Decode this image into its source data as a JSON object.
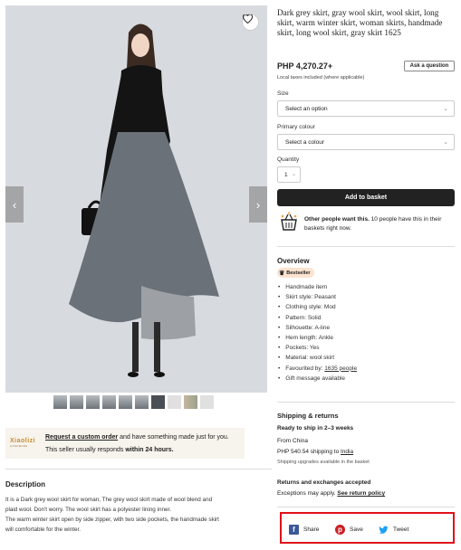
{
  "gallery": {
    "favorite_icon": "heart-icon",
    "prev_icon": "chevron-left-icon",
    "next_icon": "chevron-right-icon",
    "prev_glyph": "‹",
    "next_glyph": "›",
    "thumbnail_count": 10
  },
  "seller": {
    "logo_text": "Xiaolizi",
    "logo_subtext": "HANDMADE",
    "request_link": "Request a custom order",
    "request_rest": " and have something made just for you.",
    "responds_prefix": "This seller usually responds ",
    "responds_time": "within 24 hours."
  },
  "description": {
    "title": "Description",
    "lines": [
      "It is a Dark grey wool skirt for woman, The grey wool skirt made of wool blend and",
      "plaid wool. Don't worry. The wool skirt has a polyester lining inner.",
      "The warm winter skirt open by side zipper, with two side pockets, the handmade skirt",
      "will comfortable for the winter."
    ]
  },
  "product": {
    "title": "Dark grey skirt, gray wool skirt, wool skirt, long skirt, warm winter skirt, woman skirts, handmade skirt, long wool skirt, gray skirt 1625",
    "price": "PHP 4,270.27+",
    "ask_button": "Ask a question",
    "tax_note": "Local taxes included (where applicable)"
  },
  "options": {
    "size_label": "Size",
    "size_value": "Select an option",
    "colour_label": "Primary colour",
    "colour_value": "Select a colour",
    "quantity_label": "Quantity",
    "quantity_value": "1",
    "caret": "⌄",
    "add_to_basket": "Add to basket"
  },
  "demand": {
    "bold": "Other people want this.",
    "rest": " 10 people have this in their baskets right now."
  },
  "overview": {
    "title": "Overview",
    "badge": "Bestseller",
    "items": [
      "Handmade item",
      "Skirt style: Peasant",
      "Clothing style: Mod",
      "Pattern: Solid",
      "Silhouette: A-line",
      "Hem length: Ankle",
      "Pockets: Yes",
      "Material: wool skirt",
      "Favourited by: ",
      "Gift message available"
    ],
    "favourited_link": "1635 people"
  },
  "shipping": {
    "title": "Shipping & returns",
    "ready": "Ready to ship in 2–3 weeks",
    "from": "From China",
    "cost_prefix": "PHP 540.54 shipping to ",
    "cost_dest": "India",
    "upgrades": "Shipping upgrades available in the basket",
    "returns_title": "Returns and exchanges accepted",
    "returns_prefix": "Exceptions may apply. ",
    "returns_link": "See return policy"
  },
  "share": {
    "items": [
      {
        "label": "Share",
        "icon": "facebook-icon",
        "color": "#3b5998"
      },
      {
        "label": "Save",
        "icon": "pinterest-icon",
        "color": "#cb2027"
      },
      {
        "label": "Tweet",
        "icon": "twitter-icon",
        "color": "#1da1f2"
      }
    ],
    "highlight_color": "#e0121a"
  }
}
